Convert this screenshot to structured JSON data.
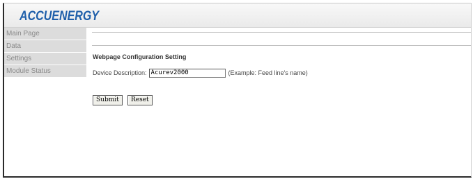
{
  "brand": {
    "logo_text": "ACCUENERGY"
  },
  "sidebar": {
    "items": [
      {
        "label": "Main Page"
      },
      {
        "label": "Data"
      },
      {
        "label": "Settings"
      },
      {
        "label": "Module Status"
      }
    ]
  },
  "main": {
    "section_title": "Webpage Configuration Setting",
    "device_description": {
      "label": "Device Description:",
      "value": "Acurev2000",
      "hint": "(Example: Feed line's name)"
    },
    "buttons": {
      "submit": "Submit",
      "reset": "Reset"
    }
  },
  "colors": {
    "logo": "#1f5faa",
    "sidebar_bg": "#dcdcdc"
  }
}
